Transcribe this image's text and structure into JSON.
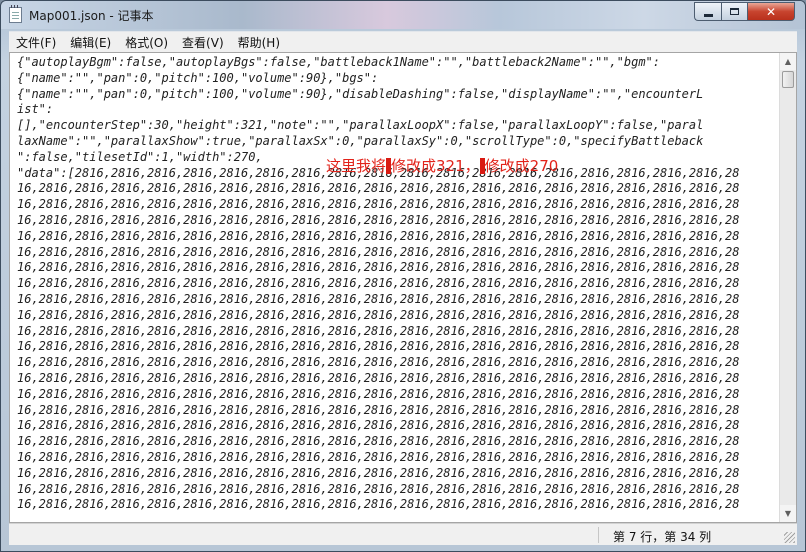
{
  "window": {
    "title": "Map001.json - 记事本",
    "close_glyph": "✕"
  },
  "menu": [
    "文件(F)",
    "编辑(E)",
    "格式(O)",
    "查看(V)",
    "帮助(H)"
  ],
  "text_lines": [
    "{\"autoplayBgm\":false,\"autoplayBgs\":false,\"battleback1Name\":\"\",\"battleback2Name\":\"\",\"bgm\":",
    "{\"name\":\"\",\"pan\":0,\"pitch\":100,\"volume\":90},\"bgs\":",
    "{\"name\":\"\",\"pan\":0,\"pitch\":100,\"volume\":90},\"disableDashing\":false,\"displayName\":\"\",\"encounterL",
    "ist\":",
    "[],\"encounterStep\":30,\"height\":321,\"note\":\"\",\"parallaxLoopX\":false,\"parallaxLoopY\":false,\"paral",
    "laxName\":\"\",\"parallaxShow\":true,\"parallaxSx\":0,\"parallaxSy\":0,\"scrollType\":0,\"specifyBattleback",
    "\":false,\"tilesetId\":1,\"width\":270,",
    "\"data\":[2816,2816,2816,2816,2816,2816,2816,2816,2816,2816,2816,2816,2816,2816,2816,2816,2816,2816,28",
    "16,2816,2816,2816,2816,2816,2816,2816,2816,2816,2816,2816,2816,2816,2816,2816,2816,2816,2816,2816,28",
    "16,2816,2816,2816,2816,2816,2816,2816,2816,2816,2816,2816,2816,2816,2816,2816,2816,2816,2816,2816,28",
    "16,2816,2816,2816,2816,2816,2816,2816,2816,2816,2816,2816,2816,2816,2816,2816,2816,2816,2816,2816,28",
    "16,2816,2816,2816,2816,2816,2816,2816,2816,2816,2816,2816,2816,2816,2816,2816,2816,2816,2816,2816,28",
    "16,2816,2816,2816,2816,2816,2816,2816,2816,2816,2816,2816,2816,2816,2816,2816,2816,2816,2816,2816,28",
    "16,2816,2816,2816,2816,2816,2816,2816,2816,2816,2816,2816,2816,2816,2816,2816,2816,2816,2816,2816,28",
    "16,2816,2816,2816,2816,2816,2816,2816,2816,2816,2816,2816,2816,2816,2816,2816,2816,2816,2816,2816,28",
    "16,2816,2816,2816,2816,2816,2816,2816,2816,2816,2816,2816,2816,2816,2816,2816,2816,2816,2816,2816,28",
    "16,2816,2816,2816,2816,2816,2816,2816,2816,2816,2816,2816,2816,2816,2816,2816,2816,2816,2816,2816,28",
    "16,2816,2816,2816,2816,2816,2816,2816,2816,2816,2816,2816,2816,2816,2816,2816,2816,2816,2816,2816,28",
    "16,2816,2816,2816,2816,2816,2816,2816,2816,2816,2816,2816,2816,2816,2816,2816,2816,2816,2816,2816,28",
    "16,2816,2816,2816,2816,2816,2816,2816,2816,2816,2816,2816,2816,2816,2816,2816,2816,2816,2816,2816,28",
    "16,2816,2816,2816,2816,2816,2816,2816,2816,2816,2816,2816,2816,2816,2816,2816,2816,2816,2816,2816,28",
    "16,2816,2816,2816,2816,2816,2816,2816,2816,2816,2816,2816,2816,2816,2816,2816,2816,2816,2816,2816,28",
    "16,2816,2816,2816,2816,2816,2816,2816,2816,2816,2816,2816,2816,2816,2816,2816,2816,2816,2816,2816,28",
    "16,2816,2816,2816,2816,2816,2816,2816,2816,2816,2816,2816,2816,2816,2816,2816,2816,2816,2816,2816,28",
    "16,2816,2816,2816,2816,2816,2816,2816,2816,2816,2816,2816,2816,2816,2816,2816,2816,2816,2816,2816,28",
    "16,2816,2816,2816,2816,2816,2816,2816,2816,2816,2816,2816,2816,2816,2816,2816,2816,2816,2816,2816,28",
    "16,2816,2816,2816,2816,2816,2816,2816,2816,2816,2816,2816,2816,2816,2816,2816,2816,2816,2816,2816,28",
    "16,2816,2816,2816,2816,2816,2816,2816,2816,2816,2816,2816,2816,2816,2816,2816,2816,2816,2816,2816,28",
    "16,2816,2816,2816,2816,2816,2816,2816,2816,2816,2816,2816,2816,2816,2816,2816,2816,2816,2816,2816,28"
  ],
  "annotation": {
    "part1": "这里我将",
    "part2": "修改成321，",
    "part3": "修改成270",
    "color": "#e2231a"
  },
  "status": {
    "position": "第 7 行，第 34 列"
  }
}
